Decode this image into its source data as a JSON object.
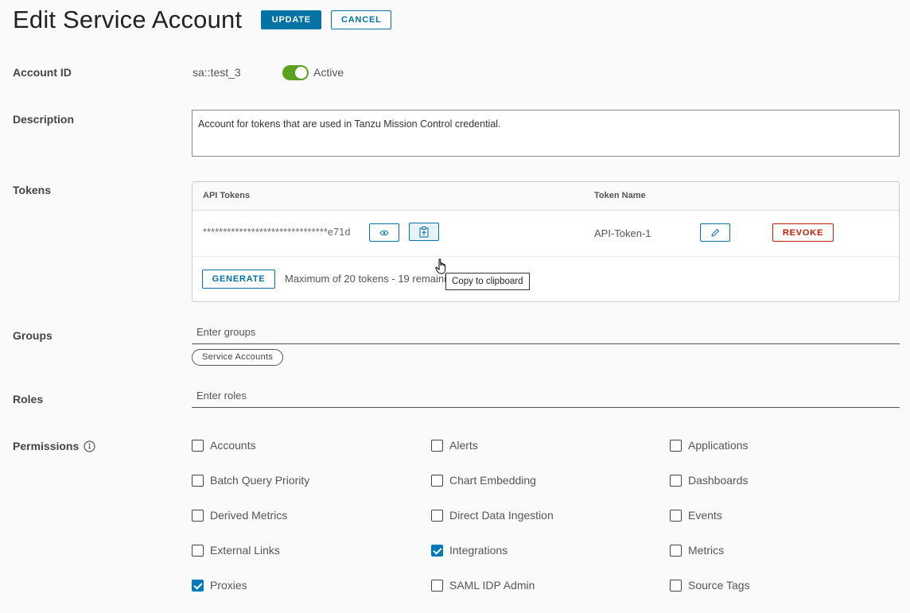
{
  "header": {
    "title": "Edit Service Account",
    "update_label": "UPDATE",
    "cancel_label": "CANCEL"
  },
  "labels": {
    "account_id": "Account ID",
    "description": "Description",
    "tokens": "Tokens",
    "groups": "Groups",
    "roles": "Roles",
    "permissions": "Permissions"
  },
  "account": {
    "id_value": "sa::test_3",
    "active_toggle_on": true,
    "active_label": "Active",
    "description": "Account for tokens that are used in Tanzu Mission Control credential."
  },
  "tokens": {
    "col_api_tokens": "API Tokens",
    "col_token_name": "Token Name",
    "rows": [
      {
        "masked_token": "*******************************e71d",
        "token_name": "API-Token-1",
        "revoke_label": "REVOKE"
      }
    ],
    "tooltip": "Copy to clipboard",
    "generate_label": "GENERATE",
    "limit_note": "Maximum of 20 tokens - 19 remaining"
  },
  "groups": {
    "placeholder": "Enter groups",
    "chips": [
      "Service Accounts"
    ]
  },
  "roles": {
    "placeholder": "Enter roles"
  },
  "permissions": [
    {
      "label": "Accounts",
      "checked": false
    },
    {
      "label": "Alerts",
      "checked": false
    },
    {
      "label": "Applications",
      "checked": false
    },
    {
      "label": "Batch Query Priority",
      "checked": false
    },
    {
      "label": "Chart Embedding",
      "checked": false
    },
    {
      "label": "Dashboards",
      "checked": false
    },
    {
      "label": "Derived Metrics",
      "checked": false
    },
    {
      "label": "Direct Data Ingestion",
      "checked": false
    },
    {
      "label": "Events",
      "checked": false
    },
    {
      "label": "External Links",
      "checked": false
    },
    {
      "label": "Integrations",
      "checked": true
    },
    {
      "label": "Metrics",
      "checked": false
    },
    {
      "label": "Proxies",
      "checked": true
    },
    {
      "label": "SAML IDP Admin",
      "checked": false
    },
    {
      "label": "Source Tags",
      "checked": false
    }
  ],
  "colors": {
    "primary": "#0072a3",
    "danger": "#c21d00",
    "toggle_on": "#5aa220",
    "checkbox_checked": "#0079b8"
  }
}
